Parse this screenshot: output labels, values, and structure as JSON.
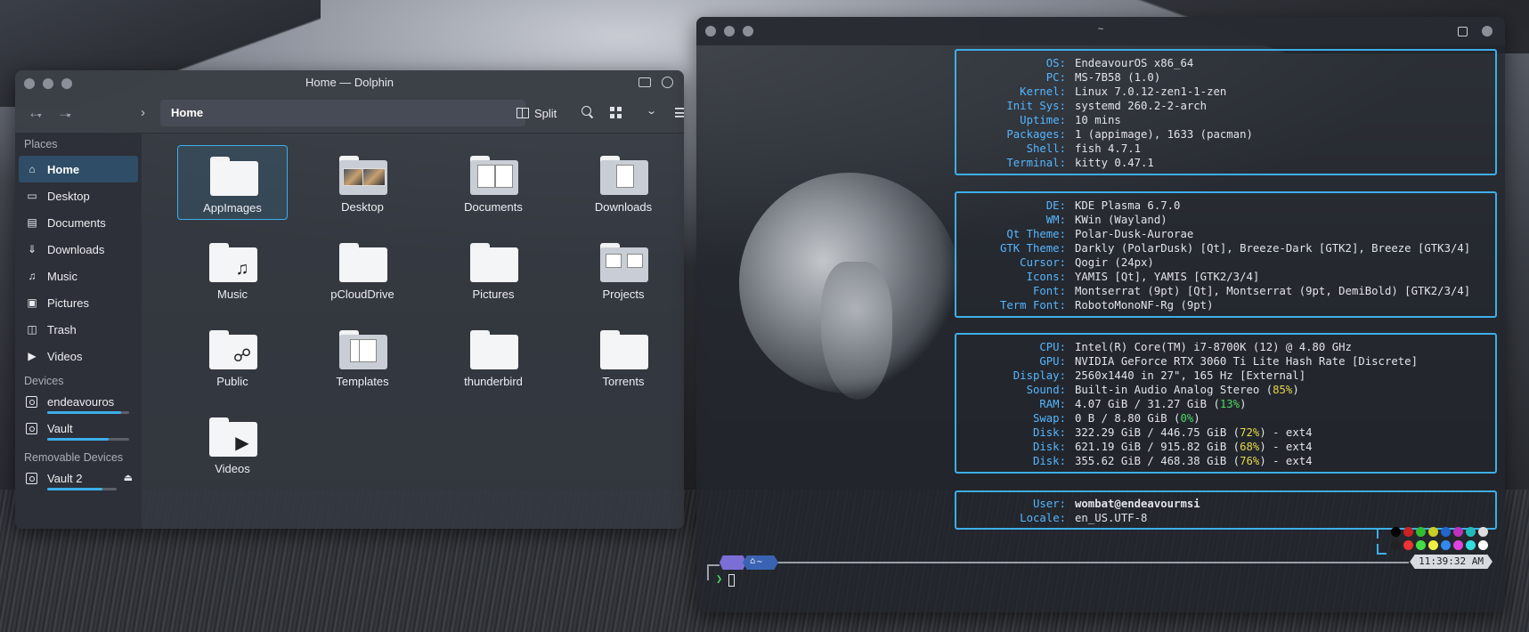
{
  "dolphin": {
    "title": "Home — Dolphin",
    "location": "Home",
    "split_label": "Split",
    "places_header": "Places",
    "places": [
      {
        "label": "Home",
        "icon": "home-icon"
      },
      {
        "label": "Desktop",
        "icon": "desktop-icon"
      },
      {
        "label": "Documents",
        "icon": "documents-icon"
      },
      {
        "label": "Downloads",
        "icon": "downloads-icon"
      },
      {
        "label": "Music",
        "icon": "music-icon"
      },
      {
        "label": "Pictures",
        "icon": "pictures-icon"
      },
      {
        "label": "Trash",
        "icon": "trash-icon"
      },
      {
        "label": "Videos",
        "icon": "videos-icon"
      }
    ],
    "devices_header": "Devices",
    "devices": [
      {
        "label": "endeavouros",
        "usage": 0.9
      },
      {
        "label": "Vault",
        "usage": 0.75
      }
    ],
    "removable_header": "Removable Devices",
    "removable": [
      {
        "label": "Vault 2",
        "usage": 0.8
      }
    ],
    "files": [
      "AppImages",
      "Desktop",
      "Documents",
      "Downloads",
      "Music",
      "pCloudDrive",
      "Pictures",
      "Projects",
      "Public",
      "Templates",
      "thunderbird",
      "Torrents",
      "Videos"
    ],
    "colors": {
      "accent": "#3daee9",
      "selection": "#2f4d66"
    }
  },
  "terminal": {
    "title": "~",
    "system": [
      {
        "k": "OS:",
        "v": "EndeavourOS x86_64"
      },
      {
        "k": "PC:",
        "v": "MS-7B58 (1.0)"
      },
      {
        "k": "Kernel:",
        "v": "Linux 7.0.12-zen1-1-zen"
      },
      {
        "k": "Init Sys:",
        "v": "systemd 260.2-2-arch"
      },
      {
        "k": "Uptime:",
        "v": "10 mins"
      },
      {
        "k": "Packages:",
        "v": "1 (appimage), 1633 (pacman)"
      },
      {
        "k": "Shell:",
        "v": "fish 4.7.1"
      },
      {
        "k": "Terminal:",
        "v": "kitty 0.47.1"
      }
    ],
    "desktop": [
      {
        "k": "DE:",
        "v": "KDE Plasma 6.7.0"
      },
      {
        "k": "WM:",
        "v": "KWin (Wayland)"
      },
      {
        "k": "Qt Theme:",
        "v": "Polar-Dusk-Aurorae"
      },
      {
        "k": "GTK Theme:",
        "v": "Darkly (PolarDusk) [Qt], Breeze-Dark [GTK2], Breeze [GTK3/4]"
      },
      {
        "k": "Cursor:",
        "v": "Qogir (24px)"
      },
      {
        "k": "Icons:",
        "v": "YAMIS [Qt], YAMIS [GTK2/3/4]"
      },
      {
        "k": "Font:",
        "v": "Montserrat (9pt) [Qt], Montserrat (9pt, DemiBold) [GTK2/3/4]"
      },
      {
        "k": "Term Font:",
        "v": "RobotoMonoNF-Rg (9pt)"
      }
    ],
    "hardware": {
      "cpu_k": "CPU:",
      "cpu_v": "Intel(R) Core(TM) i7-8700K (12) @ 4.80 GHz",
      "gpu_k": "GPU:",
      "gpu_v": "NVIDIA GeForce RTX 3060 Ti Lite Hash Rate [Discrete]",
      "display_k": "Display:",
      "display_v": "2560x1440 in 27\", 165 Hz [External]",
      "sound_k": "Sound:",
      "sound_a": "Built-in Audio Analog Stereo (",
      "sound_p": "85%",
      "sound_b": ")",
      "ram_k": "RAM:",
      "ram_a": "4.07 GiB / 31.27 GiB (",
      "ram_p": "13%",
      "ram_b": ")",
      "swap_k": "Swap:",
      "swap_a": "0 B / 8.80 GiB (",
      "swap_p": "0%",
      "swap_b": ")",
      "disks": [
        {
          "k": "Disk:",
          "a": "322.29 GiB / 446.75 GiB (",
          "p": "72%",
          "b": ") - ext4"
        },
        {
          "k": "Disk:",
          "a": "621.19 GiB / 915.82 GiB (",
          "p": "68%",
          "b": ") - ext4"
        },
        {
          "k": "Disk:",
          "a": "355.62 GiB / 468.38 GiB (",
          "p": "76%",
          "b": ") - ext4"
        }
      ]
    },
    "user": [
      {
        "k": "User:",
        "v": "wombat@endeavourmsi"
      },
      {
        "k": "Locale:",
        "v": "en_US.UTF-8"
      }
    ],
    "palette_row1": [
      "#000000",
      "#cc2222",
      "#33bb33",
      "#cccc22",
      "#2266cc",
      "#bb33bb",
      "#22bbbb",
      "#dddddd"
    ],
    "palette_row2": [
      "#222222",
      "#ee3333",
      "#44dd44",
      "#eeee44",
      "#3388ee",
      "#dd44dd",
      "#33dddd",
      "#ffffff"
    ],
    "prompt": {
      "home": "~",
      "time": "11:39:32 AM"
    },
    "colors": {
      "key": "#56b6ff",
      "border": "#3daee9",
      "pct_yellow": "#e5d84b",
      "pct_green": "#4cd964"
    }
  }
}
